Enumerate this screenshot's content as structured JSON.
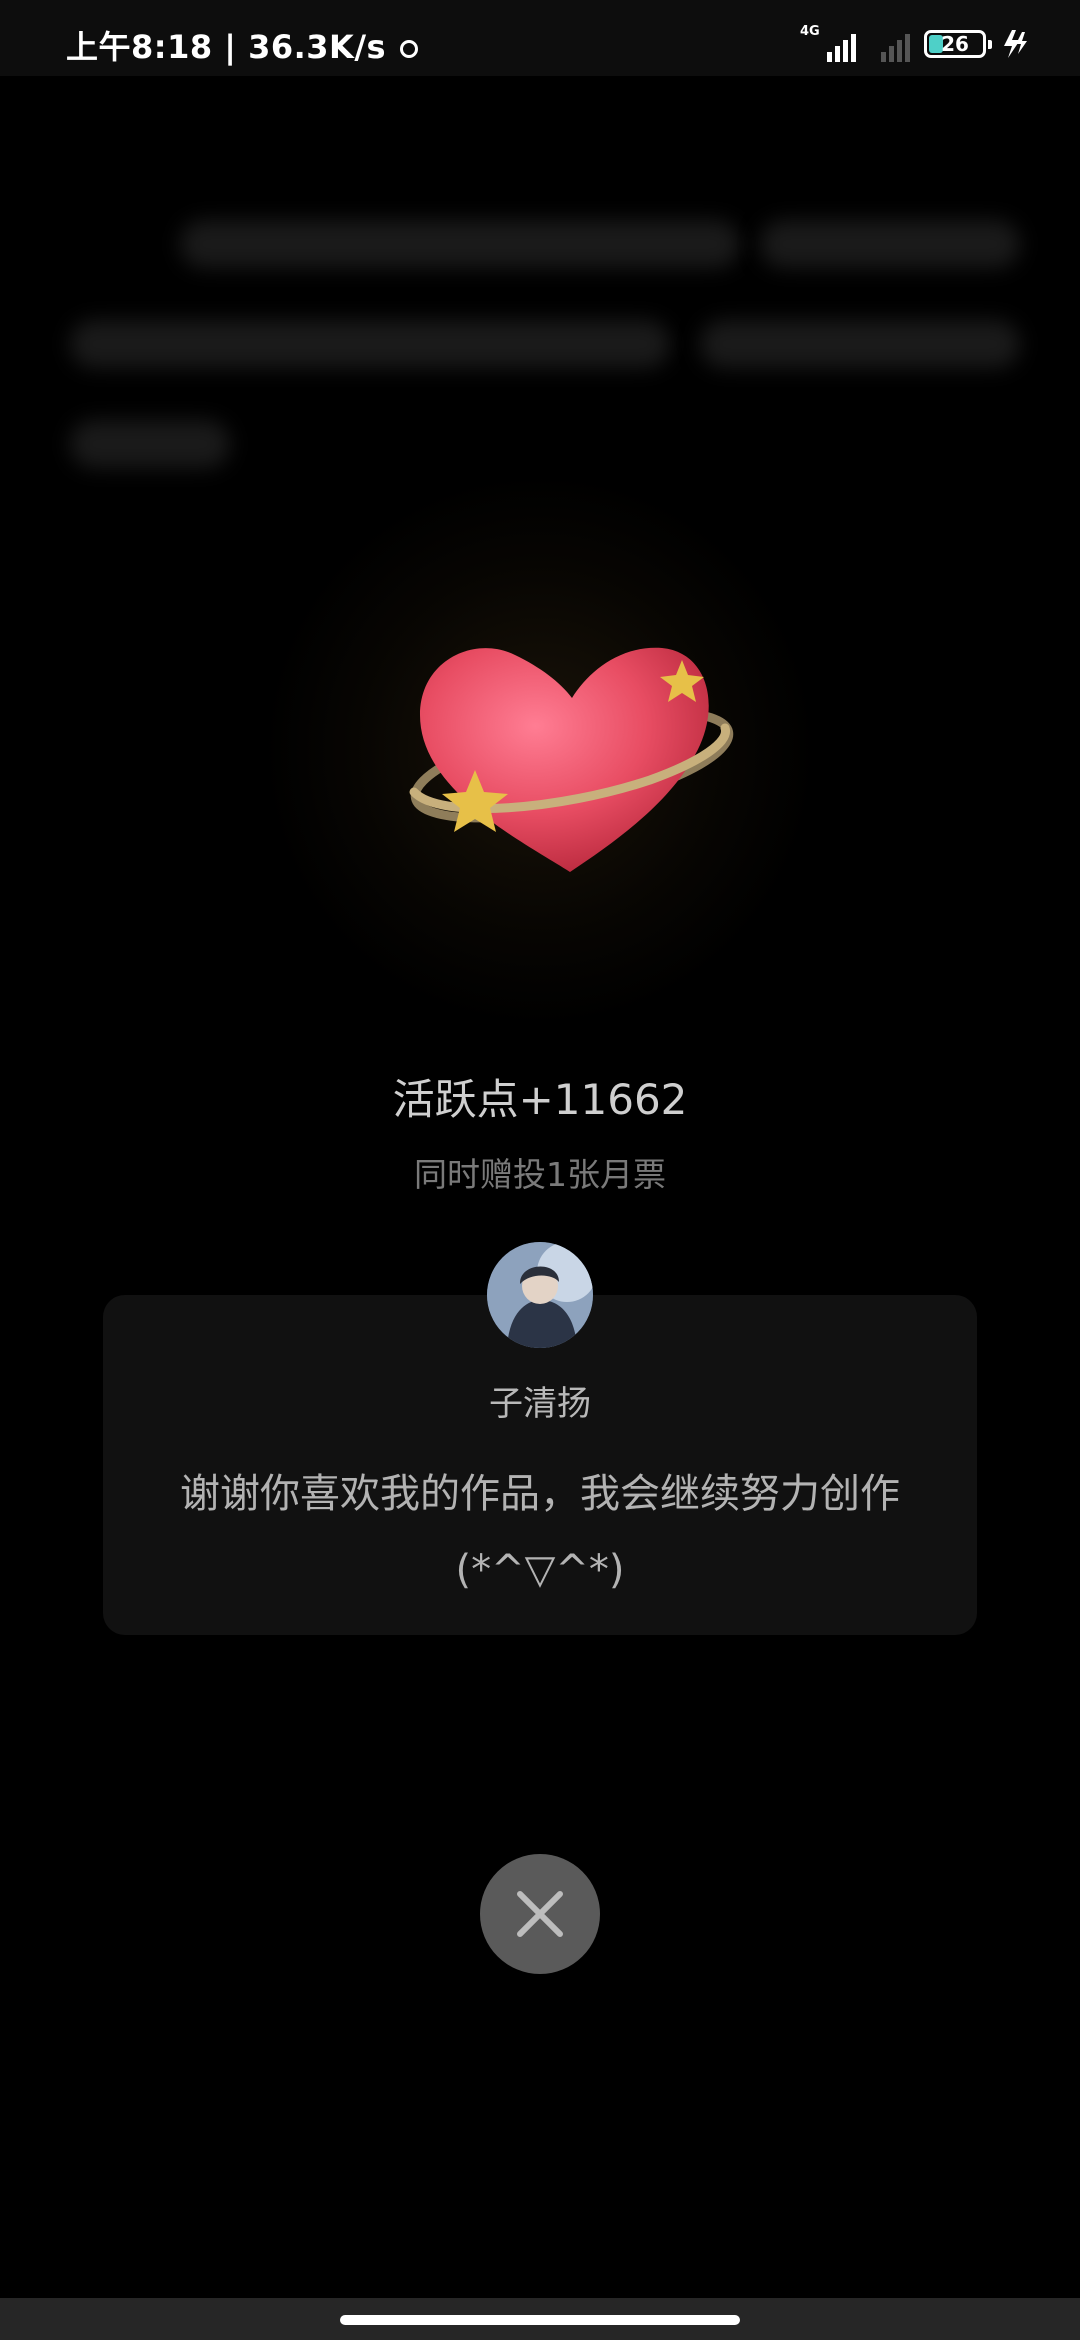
{
  "status_bar": {
    "time_speed": "上午8:18 | 36.3K/s",
    "network": "4G",
    "battery_level": "26"
  },
  "reward": {
    "title": "活跃点+11662",
    "subtitle": "同时赠投1张月票"
  },
  "author_card": {
    "author_name": "子清扬",
    "message": "谢谢你喜欢我的作品，我会继续努力创作(*^▽^*)"
  },
  "icons": {
    "close": "close-icon",
    "heart": "heart-with-stars-icon",
    "charging": "charging-icon"
  },
  "colors": {
    "background": "#000000",
    "close_button": "#5a5a5a",
    "battery_fill": "#4ed0c8"
  }
}
